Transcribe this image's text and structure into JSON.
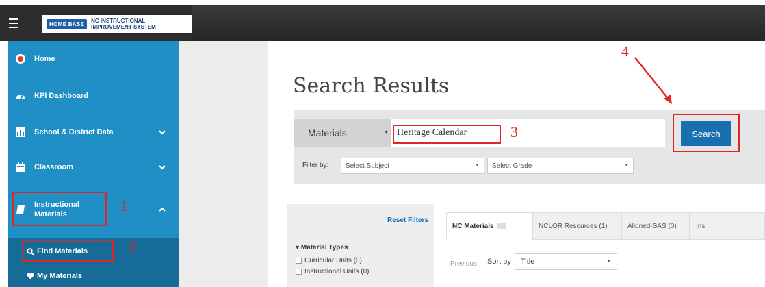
{
  "header": {
    "logo_label": "HOME BASE",
    "system_line1": "NC INSTRUCTIONAL",
    "system_line2": "IMPROVEMENT SYSTEM",
    "menu_icon": "hamburger-icon"
  },
  "sidebar": {
    "items": [
      {
        "label": "Home",
        "icon": "home-icon"
      },
      {
        "label": "KPI Dashboard",
        "icon": "dashboard-icon"
      },
      {
        "label": "School & District Data",
        "icon": "bar-chart-icon"
      },
      {
        "label": "Classroom",
        "icon": "calendar-icon"
      },
      {
        "label": "Instructional",
        "label2": "Materials",
        "icon": "book-icon"
      }
    ],
    "submenu": [
      {
        "label": "Find Materials",
        "icon": "search-icon"
      },
      {
        "label": "My Materials",
        "icon": "heart-icon"
      }
    ]
  },
  "annotations": {
    "n1": "1",
    "n2": "2",
    "n3": "3",
    "n4": "4"
  },
  "main": {
    "title": "Search Results",
    "search": {
      "type_label": "Materials",
      "query": "Heritage Calendar",
      "button_label": "Search"
    },
    "filters": {
      "label": "Filter by:",
      "subject": "Select Subject",
      "grade": "Select Grade"
    },
    "left_panel": {
      "reset": "Reset Filters",
      "section": "Material Types",
      "options": [
        "Curricular Units  (0)",
        "Instructional Units  (0)"
      ]
    },
    "tabs": [
      {
        "label": "NC Materials"
      },
      {
        "label": "NCLOR Resources (1)"
      },
      {
        "label": "Aligned-SAS (0)"
      },
      {
        "label": "Ins"
      }
    ],
    "pagination": {
      "previous": "Previous",
      "sort_label": "Sort by",
      "sort_value": "Title"
    }
  },
  "colors": {
    "sidebar": "#1f8fc6",
    "submenu": "#166c97",
    "annotation_red": "#e02626",
    "search_button": "#1a6fb0"
  }
}
